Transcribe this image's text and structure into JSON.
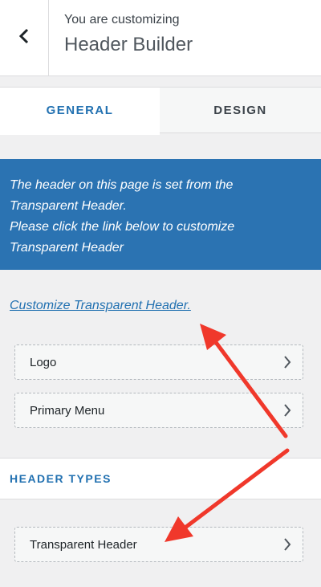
{
  "header": {
    "subtitle": "You are customizing",
    "title": "Header Builder",
    "back_icon": "chevron-left-icon"
  },
  "tabs": [
    {
      "label": "GENERAL",
      "active": true
    },
    {
      "label": "DESIGN",
      "active": false
    }
  ],
  "notice": {
    "line1": "The header on this page is set from the",
    "line2": "Transparent Header.",
    "line3": "Please click the link below to customize",
    "line4": "Transparent Header",
    "background": "#2b73b2"
  },
  "link": {
    "text": "Customize Transparent Header."
  },
  "items": [
    {
      "label": "Logo",
      "icon": "chevron-right-icon"
    },
    {
      "label": "Primary Menu",
      "icon": "chevron-right-icon"
    }
  ],
  "section": {
    "title": "HEADER TYPES",
    "items": [
      {
        "label": "Transparent Header",
        "icon": "chevron-right-icon"
      }
    ]
  },
  "annotation": {
    "arrow_color": "#f0382b"
  }
}
